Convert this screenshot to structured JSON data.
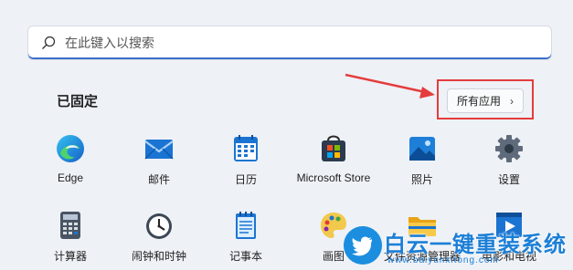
{
  "search": {
    "placeholder": "在此键入以搜索"
  },
  "pinned": {
    "title": "已固定",
    "all_apps_label": "所有应用",
    "all_apps_chevron": "›"
  },
  "apps": [
    {
      "label": "Edge",
      "icon": "edge-icon"
    },
    {
      "label": "邮件",
      "icon": "mail-icon"
    },
    {
      "label": "日历",
      "icon": "calendar-icon"
    },
    {
      "label": "Microsoft Store",
      "icon": "store-icon"
    },
    {
      "label": "照片",
      "icon": "photos-icon"
    },
    {
      "label": "设置",
      "icon": "settings-icon"
    },
    {
      "label": "计算器",
      "icon": "calculator-icon"
    },
    {
      "label": "闹钟和时钟",
      "icon": "clock-icon"
    },
    {
      "label": "记事本",
      "icon": "notepad-icon"
    },
    {
      "label": "画图",
      "icon": "paint-icon"
    },
    {
      "label": "文件资源管理器",
      "icon": "folder-icon"
    },
    {
      "label": "电影和电视",
      "icon": "movies-icon"
    }
  ],
  "watermark": {
    "text": "白云一键重装系统",
    "url": "www.baiyunxitong.com"
  },
  "colors": {
    "accent": "#3b6fcf",
    "annotation": "#e43c3c",
    "watermark": "#1c7fd6"
  }
}
